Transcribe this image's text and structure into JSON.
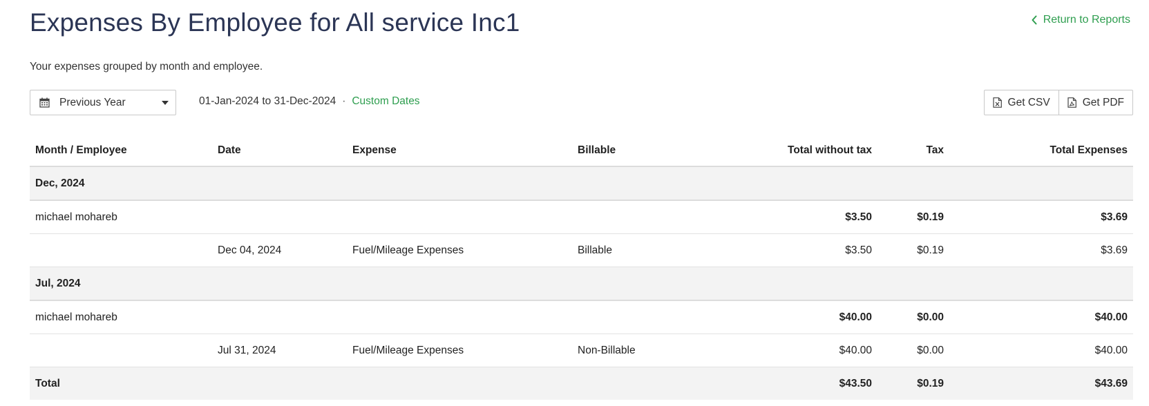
{
  "header": {
    "title": "Expenses By Employee for All service Inc1",
    "return_label": "Return to Reports",
    "subtitle": "Your expenses grouped by month and employee."
  },
  "filters": {
    "period": "Previous Year",
    "date_range": "01-Jan-2024 to 31-Dec-2024",
    "separator": "·",
    "custom_dates": "Custom Dates"
  },
  "export": {
    "csv_label": "Get CSV",
    "pdf_label": "Get PDF"
  },
  "table": {
    "columns": [
      "Month / Employee",
      "Date",
      "Expense",
      "Billable",
      "Total without tax",
      "Tax",
      "Total Expenses"
    ],
    "groups": [
      {
        "month": "Dec, 2024",
        "employee": "michael mohareb",
        "employee_total_without_tax": "$3.50",
        "employee_tax": "$0.19",
        "employee_total": "$3.69",
        "item": {
          "date": "Dec 04, 2024",
          "expense": "Fuel/Mileage Expenses",
          "billable": "Billable",
          "total_without_tax": "$3.50",
          "tax": "$0.19",
          "total": "$3.69"
        }
      },
      {
        "month": "Jul, 2024",
        "employee": "michael mohareb",
        "employee_total_without_tax": "$40.00",
        "employee_tax": "$0.00",
        "employee_total": "$40.00",
        "item": {
          "date": "Jul 31, 2024",
          "expense": "Fuel/Mileage Expenses",
          "billable": "Non-Billable",
          "total_without_tax": "$40.00",
          "tax": "$0.00",
          "total": "$40.00"
        }
      }
    ],
    "total": {
      "label": "Total",
      "total_without_tax": "$43.50",
      "tax": "$0.19",
      "total": "$43.69"
    }
  },
  "colors": {
    "title": "#2b3555",
    "link": "#2e9e4f",
    "row_shade": "#f3f3f3"
  },
  "icons": {
    "return": "chevron-left-icon",
    "period": "calendar-icon",
    "dropdown": "caret-down-icon",
    "csv": "excel-file-icon",
    "pdf": "pdf-file-icon"
  }
}
